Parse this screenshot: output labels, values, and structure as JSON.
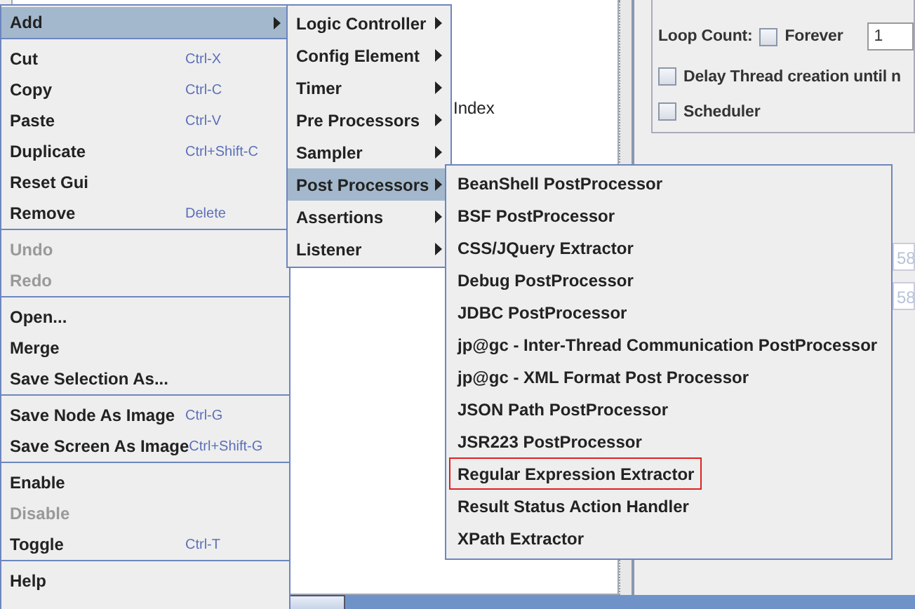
{
  "tree_panel": {
    "label": "Index"
  },
  "thread_group": {
    "loop_count_label": "Loop Count:",
    "forever": {
      "label": "Forever",
      "checked": false
    },
    "loop_count": "1",
    "delay_thread": {
      "label": "Delay Thread creation until n",
      "checked": false
    },
    "scheduler": {
      "label": "Scheduler",
      "checked": false
    },
    "fields": [
      "58",
      "58"
    ]
  },
  "context_menu": {
    "items": [
      {
        "kind": "item",
        "label": "Add",
        "submenu": true,
        "selected": true,
        "disabled": false
      },
      {
        "kind": "separator"
      },
      {
        "kind": "item",
        "label": "Cut",
        "shortcut": "Ctrl-X",
        "selected": false,
        "disabled": false
      },
      {
        "kind": "item",
        "label": "Copy",
        "shortcut": "Ctrl-C",
        "selected": false,
        "disabled": false
      },
      {
        "kind": "item",
        "label": "Paste",
        "shortcut": "Ctrl-V",
        "selected": false,
        "disabled": false
      },
      {
        "kind": "item",
        "label": "Duplicate",
        "shortcut": "Ctrl+Shift-C",
        "selected": false,
        "disabled": false
      },
      {
        "kind": "item",
        "label": "Reset Gui",
        "selected": false,
        "disabled": false
      },
      {
        "kind": "item",
        "label": "Remove",
        "shortcut": "Delete",
        "selected": false,
        "disabled": false
      },
      {
        "kind": "separator"
      },
      {
        "kind": "item",
        "label": "Undo",
        "selected": false,
        "disabled": true
      },
      {
        "kind": "item",
        "label": "Redo",
        "selected": false,
        "disabled": true
      },
      {
        "kind": "separator"
      },
      {
        "kind": "item",
        "label": "Open...",
        "selected": false,
        "disabled": false
      },
      {
        "kind": "item",
        "label": "Merge",
        "selected": false,
        "disabled": false
      },
      {
        "kind": "item",
        "label": "Save Selection As...",
        "selected": false,
        "disabled": false
      },
      {
        "kind": "separator"
      },
      {
        "kind": "item",
        "label": "Save Node As Image",
        "shortcut": "Ctrl-G",
        "selected": false,
        "disabled": false
      },
      {
        "kind": "item",
        "label": "Save Screen As Image",
        "shortcut": "Ctrl+Shift-G",
        "selected": false,
        "disabled": false
      },
      {
        "kind": "separator"
      },
      {
        "kind": "item",
        "label": "Enable",
        "selected": false,
        "disabled": false
      },
      {
        "kind": "item",
        "label": "Disable",
        "selected": false,
        "disabled": true
      },
      {
        "kind": "item",
        "label": "Toggle",
        "shortcut": "Ctrl-T",
        "selected": false,
        "disabled": false
      },
      {
        "kind": "separator"
      },
      {
        "kind": "item",
        "label": "Help",
        "selected": false,
        "disabled": false
      }
    ]
  },
  "add_submenu": {
    "items": [
      {
        "label": "Logic Controller",
        "submenu": true,
        "selected": false
      },
      {
        "label": "Config Element",
        "submenu": true,
        "selected": false
      },
      {
        "label": "Timer",
        "submenu": true,
        "selected": false
      },
      {
        "label": "Pre Processors",
        "submenu": true,
        "selected": false
      },
      {
        "label": "Sampler",
        "submenu": true,
        "selected": false
      },
      {
        "label": "Post Processors",
        "submenu": true,
        "selected": true
      },
      {
        "label": "Assertions",
        "submenu": true,
        "selected": false
      },
      {
        "label": "Listener",
        "submenu": true,
        "selected": false
      }
    ]
  },
  "post_processors_submenu": {
    "items": [
      {
        "label": "BeanShell PostProcessor",
        "outlined": false
      },
      {
        "label": "BSF PostProcessor",
        "outlined": false
      },
      {
        "label": "CSS/JQuery Extractor",
        "outlined": false
      },
      {
        "label": "Debug PostProcessor",
        "outlined": false
      },
      {
        "label": "JDBC PostProcessor",
        "outlined": false
      },
      {
        "label": "jp@gc - Inter-Thread Communication PostProcessor",
        "outlined": false
      },
      {
        "label": "jp@gc - XML Format Post Processor",
        "outlined": false
      },
      {
        "label": "JSON Path PostProcessor",
        "outlined": false
      },
      {
        "label": "JSR223 PostProcessor",
        "outlined": false
      },
      {
        "label": "Regular Expression Extractor",
        "outlined": true
      },
      {
        "label": "Result Status Action Handler",
        "outlined": false
      },
      {
        "label": "XPath Extractor",
        "outlined": false
      }
    ]
  }
}
